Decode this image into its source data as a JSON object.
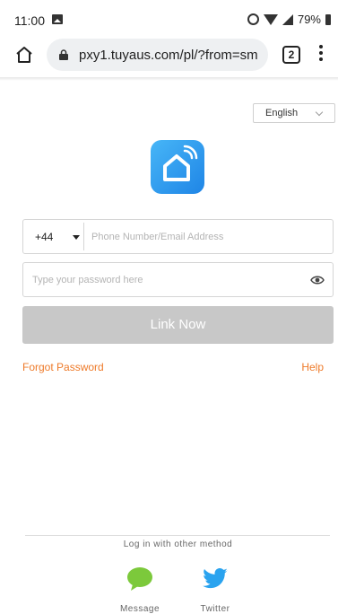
{
  "status_bar": {
    "time": "11:00",
    "battery": "79%"
  },
  "browser": {
    "url": "pxy1.tuyaus.com/pl/?from=sm",
    "tab_count": "2"
  },
  "language": {
    "selected": "English"
  },
  "login_form": {
    "country_code": "+44",
    "phone_placeholder": "Phone Number/Email Address",
    "password_placeholder": "Type your password here",
    "submit_label": "Link Now",
    "forgot_label": "Forgot Password",
    "help_label": "Help"
  },
  "other_methods": {
    "title": "Log in with other method",
    "items": [
      {
        "label": "Message",
        "icon": "message-icon",
        "color": "#7cc93b"
      },
      {
        "label": "Twitter",
        "icon": "twitter-icon",
        "color": "#2aa3ef"
      }
    ]
  },
  "colors": {
    "accent_link": "#ee7a29",
    "logo_blue": "#2a95ec",
    "button_disabled": "#c8c8c8"
  }
}
